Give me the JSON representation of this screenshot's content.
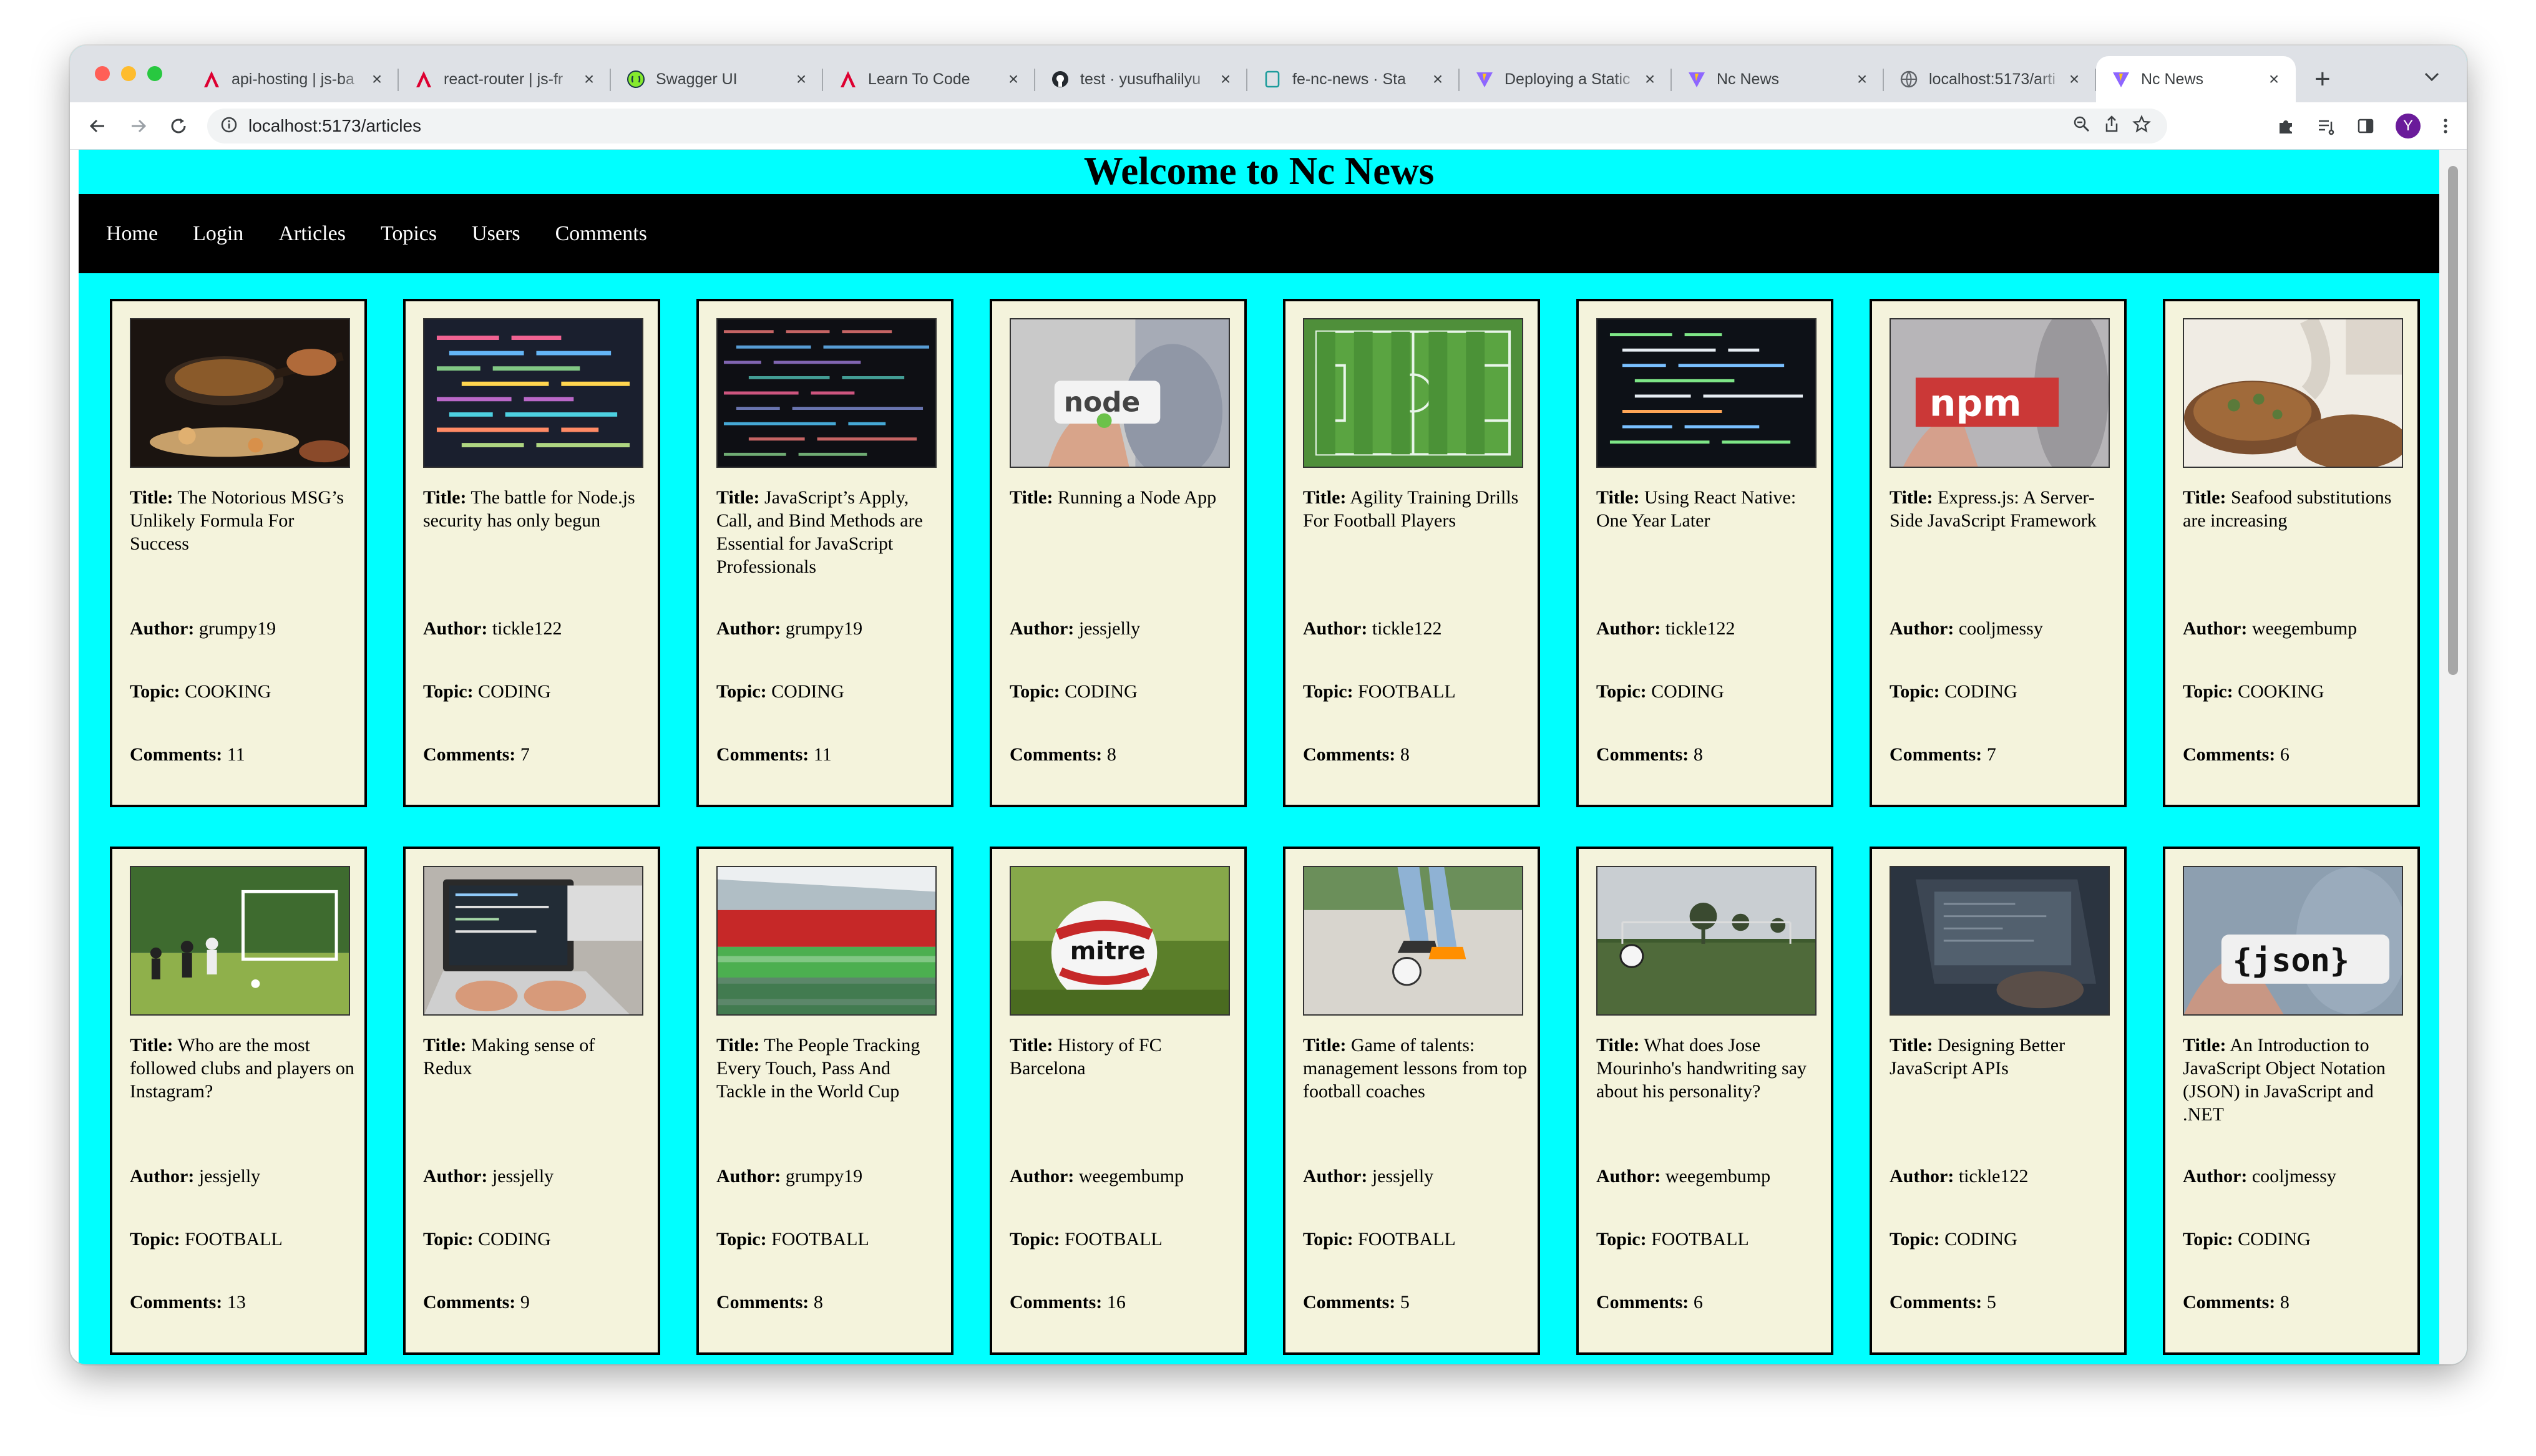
{
  "browser": {
    "tabs": [
      {
        "title": "api-hosting | js-ba",
        "icon": "angular-icon"
      },
      {
        "title": "react-router | js-fr",
        "icon": "angular-icon"
      },
      {
        "title": "Swagger UI",
        "icon": "swagger-icon"
      },
      {
        "title": "Learn To Code",
        "icon": "angular-icon"
      },
      {
        "title": "test · yusufhalilyu",
        "icon": "github-icon"
      },
      {
        "title": "fe-nc-news · Sta",
        "icon": "page-icon"
      },
      {
        "title": "Deploying a Static",
        "icon": "vite-icon"
      },
      {
        "title": "Nc News",
        "icon": "vite-icon"
      },
      {
        "title": "localhost:5173/arti",
        "icon": "globe-icon"
      },
      {
        "title": "Nc News",
        "icon": "vite-icon",
        "active": true
      }
    ],
    "url": "localhost:5173/articles",
    "profile_initial": "Y",
    "colors": {
      "accent": "#00ffff",
      "card": "#f4f3dc",
      "nav": "#000000"
    }
  },
  "page": {
    "heading": "Welcome to Nc News",
    "nav": [
      "Home",
      "Login",
      "Articles",
      "Topics",
      "Users",
      "Comments"
    ]
  },
  "labels": {
    "title": "Title:",
    "author": "Author:",
    "topic": "Topic:",
    "comments": "Comments:"
  },
  "articles": [
    {
      "title": "The Notorious MSG’s Unlikely Formula For Success",
      "author": "grumpy19",
      "topic": "COOKING",
      "comments": "11",
      "image": "cooking-pan"
    },
    {
      "title": "The battle for Node.js security has only begun",
      "author": "tickle122",
      "topic": "CODING",
      "comments": "7",
      "image": "code-colorful"
    },
    {
      "title": "JavaScript’s Apply, Call, and Bind Methods are Essential for JavaScript Professionals",
      "author": "grumpy19",
      "topic": "CODING",
      "comments": "11",
      "image": "code-dark"
    },
    {
      "title": "Running a Node App",
      "author": "jessjelly",
      "topic": "CODING",
      "comments": "8",
      "image": "node-sticker"
    },
    {
      "title": "Agility Training Drills For Football Players",
      "author": "tickle122",
      "topic": "FOOTBALL",
      "comments": "8",
      "image": "football-pitch"
    },
    {
      "title": "Using React Native: One Year Later",
      "author": "tickle122",
      "topic": "CODING",
      "comments": "8",
      "image": "code-green"
    },
    {
      "title": "Express.js: A Server-Side JavaScript Framework",
      "author": "cooljmessy",
      "topic": "CODING",
      "comments": "7",
      "image": "npm-sticker"
    },
    {
      "title": "Seafood substitutions are increasing",
      "author": "weegembump",
      "topic": "COOKING",
      "comments": "6",
      "image": "seafood"
    },
    {
      "title": "Who are the most followed clubs and players on Instagram?",
      "author": "jessjelly",
      "topic": "FOOTBALL",
      "comments": "13",
      "image": "football-match"
    },
    {
      "title": "Making sense of Redux",
      "author": "jessjelly",
      "topic": "CODING",
      "comments": "9",
      "image": "laptop-hands"
    },
    {
      "title": "The People Tracking Every Touch, Pass And Tackle in the World Cup",
      "author": "grumpy19",
      "topic": "FOOTBALL",
      "comments": "8",
      "image": "stadium"
    },
    {
      "title": "History of FC Barcelona",
      "author": "weegembump",
      "topic": "FOOTBALL",
      "comments": "16",
      "image": "mitre-ball"
    },
    {
      "title": "Game of talents: management lessons from top football coaches",
      "author": "jessjelly",
      "topic": "FOOTBALL",
      "comments": "5",
      "image": "ball-sand"
    },
    {
      "title": "What does Jose Mourinho's handwriting say about his personality?",
      "author": "weegembump",
      "topic": "FOOTBALL",
      "comments": "6",
      "image": "ball-field"
    },
    {
      "title": "Designing Better JavaScript APIs",
      "author": "tickle122",
      "topic": "CODING",
      "comments": "5",
      "image": "laptop-dark"
    },
    {
      "title": "An Introduction to JavaScript Object Notation (JSON) in JavaScript and .NET",
      "author": "cooljmessy",
      "topic": "CODING",
      "comments": "8",
      "image": "json-sticker"
    }
  ]
}
